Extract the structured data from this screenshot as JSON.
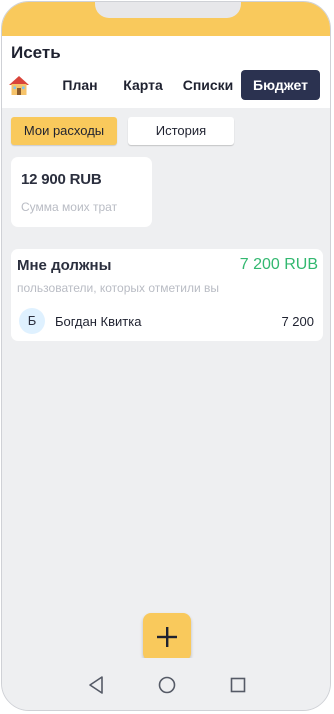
{
  "colors": {
    "accent": "#f9c95c",
    "nav_active": "#2b3250",
    "positive": "#33b870",
    "background": "#eeeff1"
  },
  "header": {
    "title": "Исеть",
    "home_icon": "home-icon",
    "tabs": [
      {
        "label": "План",
        "active": false
      },
      {
        "label": "Карта",
        "active": false
      },
      {
        "label": "Списки",
        "active": false
      },
      {
        "label": "Бюджет",
        "active": true
      }
    ]
  },
  "segment": {
    "my_expenses": "Мои расходы",
    "history": "История",
    "selected": "Мои расходы"
  },
  "spend_card": {
    "amount": "12 900 RUB",
    "caption": "Сумма моих трат"
  },
  "debt_card": {
    "title": "Мне должны",
    "total": "7 200 RUB",
    "subtitle": "пользователи, которых отметили вы",
    "debtors": [
      {
        "initial": "Б",
        "name": "Богдан Квитка",
        "amount": "7 200"
      }
    ]
  },
  "fab": {
    "icon": "plus-icon"
  },
  "system_nav": {
    "icons": [
      "back-icon",
      "home-circle-icon",
      "recents-icon"
    ]
  }
}
